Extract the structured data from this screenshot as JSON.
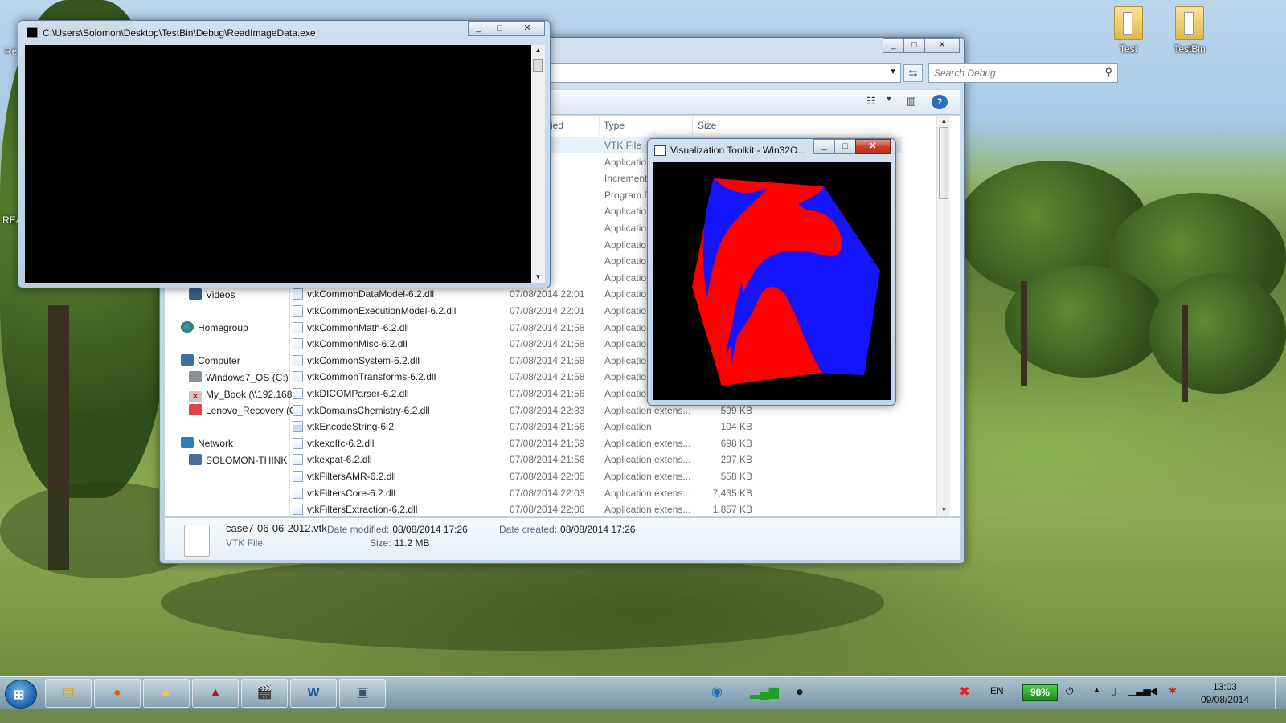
{
  "desktop": {
    "icons": [
      {
        "label": "Test"
      },
      {
        "label": "TestBin"
      }
    ],
    "partial_labels": {
      "left_top": "Re",
      "left_mid": "REA"
    }
  },
  "console": {
    "title": "C:\\Users\\Solomon\\Desktop\\TestBin\\Debug\\ReadImageData.exe"
  },
  "explorer": {
    "search_placeholder": "Search Debug",
    "columns": [
      {
        "label": "ified"
      },
      {
        "label": "Type"
      },
      {
        "label": "Size"
      }
    ],
    "nav": {
      "videos": "Videos",
      "homegroup": "Homegroup",
      "computer": "Computer",
      "drive_c": "Windows7_OS (C:)",
      "my_book": "My_Book (\\\\192.168",
      "lenovo": "Lenovo_Recovery (C",
      "network": "Network",
      "solomon": "SOLOMON-THINK"
    },
    "files": [
      {
        "name": "",
        "date": "4 17:26",
        "type": "VTK File",
        "size": ""
      },
      {
        "name": "",
        "date": "4 22:33",
        "type": "Applicatio",
        "size": ""
      },
      {
        "name": "",
        "date": "4 22:33",
        "type": "Increment",
        "size": ""
      },
      {
        "name": "",
        "date": "4 22:33",
        "type": "Program D",
        "size": ""
      },
      {
        "name": "",
        "date": "4 21:56",
        "type": "Applicatio",
        "size": ""
      },
      {
        "name": "",
        "date": "4 22:10",
        "type": "Applicatio",
        "size": ""
      },
      {
        "name": "",
        "date": "4 22:01",
        "type": "Applicatio",
        "size": ""
      },
      {
        "name": "",
        "date": "4 22:01",
        "type": "Applicatio",
        "size": ""
      },
      {
        "name": "",
        "date": "4 21:58",
        "type": "Applicatio",
        "size": ""
      },
      {
        "name": "vtkCommonDataModel-6.2.dll",
        "date": "07/08/2014 22:01",
        "type": "Applicatio",
        "size": ""
      },
      {
        "name": "vtkCommonExecutionModel-6.2.dll",
        "date": "07/08/2014 22:01",
        "type": "Applicatio",
        "size": ""
      },
      {
        "name": "vtkCommonMath-6.2.dll",
        "date": "07/08/2014 21:58",
        "type": "Applicatio",
        "size": ""
      },
      {
        "name": "vtkCommonMisc-6.2.dll",
        "date": "07/08/2014 21:58",
        "type": "Applicatio",
        "size": ""
      },
      {
        "name": "vtkCommonSystem-6.2.dll",
        "date": "07/08/2014 21:58",
        "type": "Applicatio",
        "size": ""
      },
      {
        "name": "vtkCommonTransforms-6.2.dll",
        "date": "07/08/2014 21:58",
        "type": "Applicatio",
        "size": ""
      },
      {
        "name": "vtkDICOMParser-6.2.dll",
        "date": "07/08/2014 21:56",
        "type": "Applicatio",
        "size": ""
      },
      {
        "name": "vtkDomainsChemistry-6.2.dll",
        "date": "07/08/2014 22:33",
        "type": "Application extens...",
        "size": "599 KB"
      },
      {
        "name": "vtkEncodeString-6.2",
        "date": "07/08/2014 21:56",
        "type": "Application",
        "size": "104 KB"
      },
      {
        "name": "vtkexoIIc-6.2.dll",
        "date": "07/08/2014 21:59",
        "type": "Application extens...",
        "size": "698 KB"
      },
      {
        "name": "vtkexpat-6.2.dll",
        "date": "07/08/2014 21:56",
        "type": "Application extens...",
        "size": "297 KB"
      },
      {
        "name": "vtkFiltersAMR-6.2.dll",
        "date": "07/08/2014 22:05",
        "type": "Application extens...",
        "size": "558 KB"
      },
      {
        "name": "vtkFiltersCore-6.2.dll",
        "date": "07/08/2014 22:03",
        "type": "Application extens...",
        "size": "7,435 KB"
      },
      {
        "name": "vtkFiltersExtraction-6.2.dll",
        "date": "07/08/2014 22:06",
        "type": "Application extens...",
        "size": "1,857 KB"
      }
    ],
    "details": {
      "filename": "case7-06-06-2012.vtk",
      "filetype": "VTK File",
      "modified_label": "Date modified:",
      "modified_value": "08/08/2014 17:26",
      "created_label": "Date created:",
      "created_value": "08/08/2014 17:26",
      "size_label": "Size:",
      "size_value": "11.2 MB"
    }
  },
  "vtk_window": {
    "title": "Visualization Toolkit - Win32O..."
  },
  "taskbar": {
    "apps": [
      "explorer",
      "firefox",
      "folder",
      "acrobat",
      "clapper",
      "word",
      "window"
    ],
    "language": "EN",
    "battery": "98%",
    "time": "13:03",
    "date": "09/08/2014"
  },
  "colors": {
    "cube_red": "#ff0000",
    "cube_blue": "#1414ff"
  }
}
